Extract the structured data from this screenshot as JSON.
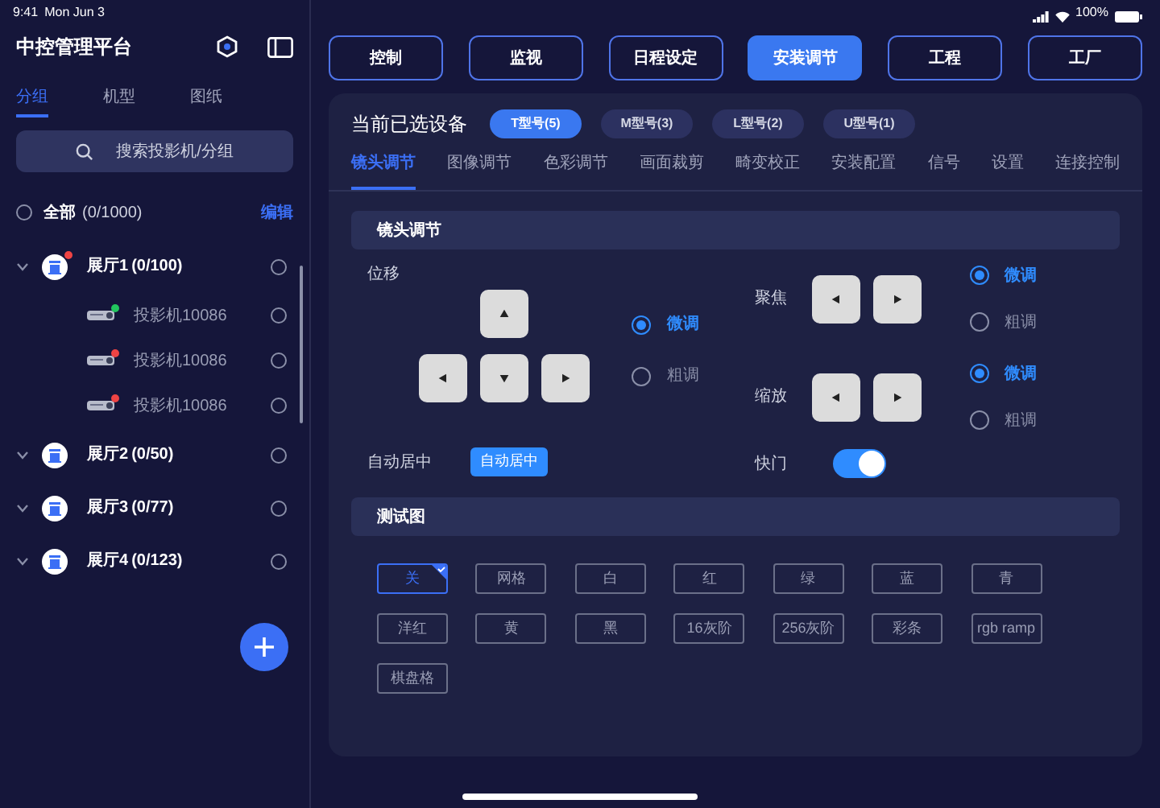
{
  "status_bar": {
    "time": "9:41",
    "date": "Mon Jun 3",
    "battery": "100%"
  },
  "sidebar": {
    "title": "中控管理平台",
    "tabs": [
      {
        "label": "分组",
        "selected": true
      },
      {
        "label": "机型",
        "selected": false
      },
      {
        "label": "图纸",
        "selected": false
      }
    ],
    "search": {
      "placeholder": "搜索投影机/分组"
    },
    "all": {
      "label": "全部",
      "count": "(0/1000)",
      "checked": false
    },
    "edit": "编辑",
    "groups": [
      {
        "name": "展厅1",
        "count": "(0/100)",
        "alert": true,
        "checked": false,
        "children": [
          {
            "name": "投影机10086",
            "color": "#22c55e",
            "checked": false
          },
          {
            "name": "投影机10086",
            "color": "#ef4444",
            "checked": false
          },
          {
            "name": "投影机10086",
            "color": "#ef4444",
            "checked": false
          }
        ]
      },
      {
        "name": "展厅2",
        "count": "(0/50)",
        "alert": false,
        "checked": false
      },
      {
        "name": "展厅3",
        "count": "(0/77)",
        "alert": false,
        "checked": false
      },
      {
        "name": "展厅4",
        "count": "(0/123)",
        "alert": false,
        "checked": false
      }
    ]
  },
  "top_nav": [
    {
      "label": "控制",
      "selected": false
    },
    {
      "label": "监视",
      "selected": false
    },
    {
      "label": "日程设定",
      "selected": false
    },
    {
      "label": "安装调节",
      "selected": true
    },
    {
      "label": "工程",
      "selected": false
    },
    {
      "label": "工厂",
      "selected": false
    }
  ],
  "panel": {
    "selected_devices": {
      "label": "当前已选设备",
      "models": [
        {
          "label": "T型号(5)",
          "selected": true
        },
        {
          "label": "M型号(3)",
          "selected": false
        },
        {
          "label": "L型号(2)",
          "selected": false
        },
        {
          "label": "U型号(1)",
          "selected": false
        }
      ]
    },
    "tabs": [
      {
        "label": "镜头调节",
        "selected": true
      },
      {
        "label": "图像调节",
        "selected": false
      },
      {
        "label": "色彩调节",
        "selected": false
      },
      {
        "label": "画面裁剪",
        "selected": false
      },
      {
        "label": "畸变校正",
        "selected": false
      },
      {
        "label": "安装配置",
        "selected": false
      },
      {
        "label": "信号",
        "selected": false
      },
      {
        "label": "设置",
        "selected": false
      },
      {
        "label": "连接控制",
        "selected": false
      }
    ],
    "lens": {
      "title": "镜头调节",
      "shift": {
        "label": "位移",
        "modes": [
          {
            "label": "微调",
            "selected": true
          },
          {
            "label": "粗调",
            "selected": false
          }
        ]
      },
      "focus": {
        "label": "聚焦",
        "modes": [
          {
            "label": "微调",
            "selected": true
          },
          {
            "label": "粗调",
            "selected": false
          }
        ]
      },
      "zoom": {
        "label": "缩放",
        "modes": [
          {
            "label": "微调",
            "selected": true
          },
          {
            "label": "粗调",
            "selected": false
          }
        ]
      },
      "auto_center": {
        "label": "自动居中",
        "button": "自动居中"
      },
      "shutter": {
        "label": "快门",
        "on": true
      }
    },
    "test_pattern": {
      "title": "测试图",
      "options": [
        {
          "label": "关",
          "selected": true
        },
        {
          "label": "网格",
          "selected": false
        },
        {
          "label": "白",
          "selected": false
        },
        {
          "label": "红",
          "selected": false
        },
        {
          "label": "绿",
          "selected": false
        },
        {
          "label": "蓝",
          "selected": false
        },
        {
          "label": "青",
          "selected": false
        },
        {
          "label": "洋红",
          "selected": false
        },
        {
          "label": "黄",
          "selected": false
        },
        {
          "label": "黑",
          "selected": false
        },
        {
          "label": "16灰阶",
          "selected": false
        },
        {
          "label": "256灰阶",
          "selected": false
        },
        {
          "label": "彩条",
          "selected": false
        },
        {
          "label": "rgb ramp",
          "selected": false
        },
        {
          "label": "棋盘格",
          "selected": false
        }
      ]
    }
  }
}
